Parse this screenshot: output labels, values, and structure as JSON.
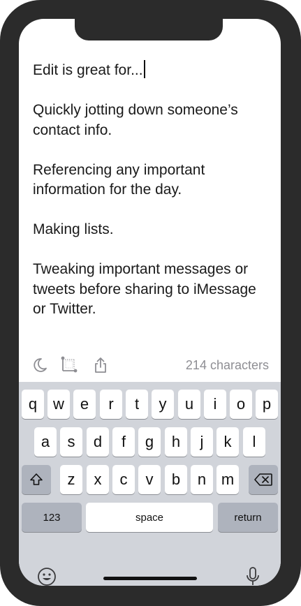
{
  "editor": {
    "paragraphs": [
      "Edit is great for...",
      "Quickly jotting down someone’s contact info.",
      "Referencing any important information for the day.",
      "Making lists.",
      "Tweaking important messages or tweets before sharing to iMessage or Twitter."
    ]
  },
  "toolbar": {
    "icons": [
      "moon-icon",
      "ruler-icon",
      "share-icon"
    ],
    "char_count": "214 characters"
  },
  "keyboard": {
    "row1": [
      "q",
      "w",
      "e",
      "r",
      "t",
      "y",
      "u",
      "i",
      "o",
      "p"
    ],
    "row2": [
      "a",
      "s",
      "d",
      "f",
      "g",
      "h",
      "j",
      "k",
      "l"
    ],
    "row3": [
      "z",
      "x",
      "c",
      "v",
      "b",
      "n",
      "m"
    ],
    "numbers_label": "123",
    "space_label": "space",
    "return_label": "return",
    "icons": [
      "shift-icon",
      "delete-icon",
      "emoji-icon",
      "microphone-icon"
    ]
  },
  "colors": {
    "frame": "#2b2b2b",
    "keyboard_bg": "#d1d4da",
    "key_bg": "#ffffff",
    "key_dark_bg": "#aeb3bd",
    "muted_text": "#8e8e93"
  }
}
